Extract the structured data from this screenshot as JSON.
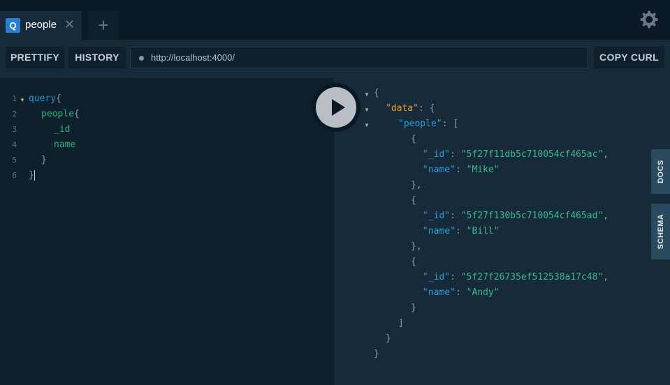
{
  "tab": {
    "badge": "Q",
    "label": "people",
    "close": "✕"
  },
  "new_tab": "+",
  "toolbar": {
    "prettify": "PRETTIFY",
    "history": "HISTORY",
    "url": "http://localhost:4000/",
    "copy_curl": "COPY CURL"
  },
  "editor": {
    "line_numbers": [
      "1",
      "2",
      "3",
      "4",
      "5",
      "6"
    ],
    "query_keyword": "query",
    "field_people": "people",
    "field_id": "_id",
    "field_name": "name",
    "open_brace": "{",
    "close_brace": "}"
  },
  "result": {
    "data_key": "\"data\"",
    "people_key": "\"people\"",
    "id_key": "\"_id\"",
    "name_key": "\"name\"",
    "people": [
      {
        "_id": "\"5f27f11db5c710054cf465ac\"",
        "name": "\"Mike\""
      },
      {
        "_id": "\"5f27f130b5c710054cf465ad\"",
        "name": "\"Bill\""
      },
      {
        "_id": "\"5f27f26735ef512538a17c48\"",
        "name": "\"Andy\""
      }
    ]
  },
  "side_tabs": {
    "docs": "DOCS",
    "schema": "SCHEMA"
  },
  "icons": {
    "settings": "gear-icon",
    "run": "play-icon"
  },
  "colors": {
    "accent": "#2a7ed2",
    "keyword": "#2d8ed1",
    "field": "#27b37e",
    "json_data_key": "#e89c1b"
  }
}
